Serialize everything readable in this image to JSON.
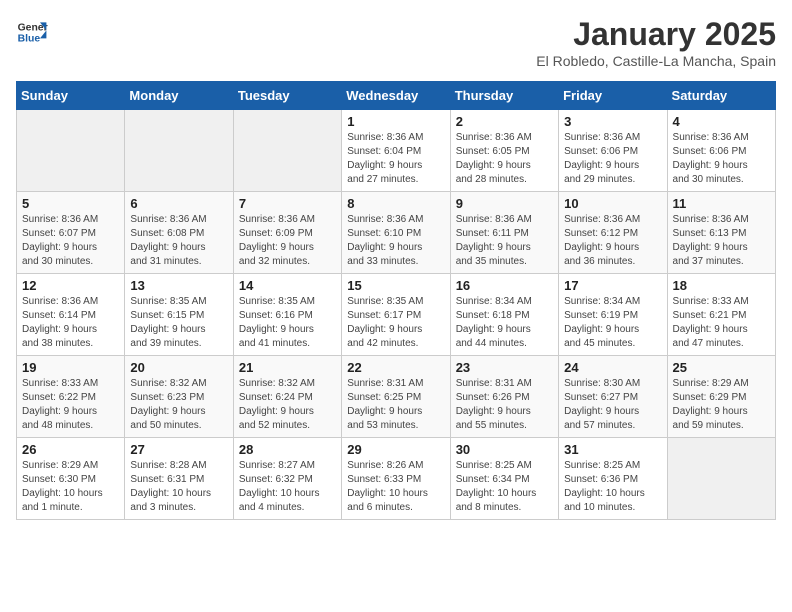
{
  "header": {
    "logo_line1": "General",
    "logo_line2": "Blue",
    "month": "January 2025",
    "location": "El Robledo, Castille-La Mancha, Spain"
  },
  "weekdays": [
    "Sunday",
    "Monday",
    "Tuesday",
    "Wednesday",
    "Thursday",
    "Friday",
    "Saturday"
  ],
  "weeks": [
    [
      {
        "day": "",
        "info": ""
      },
      {
        "day": "",
        "info": ""
      },
      {
        "day": "",
        "info": ""
      },
      {
        "day": "1",
        "info": "Sunrise: 8:36 AM\nSunset: 6:04 PM\nDaylight: 9 hours\nand 27 minutes."
      },
      {
        "day": "2",
        "info": "Sunrise: 8:36 AM\nSunset: 6:05 PM\nDaylight: 9 hours\nand 28 minutes."
      },
      {
        "day": "3",
        "info": "Sunrise: 8:36 AM\nSunset: 6:06 PM\nDaylight: 9 hours\nand 29 minutes."
      },
      {
        "day": "4",
        "info": "Sunrise: 8:36 AM\nSunset: 6:06 PM\nDaylight: 9 hours\nand 30 minutes."
      }
    ],
    [
      {
        "day": "5",
        "info": "Sunrise: 8:36 AM\nSunset: 6:07 PM\nDaylight: 9 hours\nand 30 minutes."
      },
      {
        "day": "6",
        "info": "Sunrise: 8:36 AM\nSunset: 6:08 PM\nDaylight: 9 hours\nand 31 minutes."
      },
      {
        "day": "7",
        "info": "Sunrise: 8:36 AM\nSunset: 6:09 PM\nDaylight: 9 hours\nand 32 minutes."
      },
      {
        "day": "8",
        "info": "Sunrise: 8:36 AM\nSunset: 6:10 PM\nDaylight: 9 hours\nand 33 minutes."
      },
      {
        "day": "9",
        "info": "Sunrise: 8:36 AM\nSunset: 6:11 PM\nDaylight: 9 hours\nand 35 minutes."
      },
      {
        "day": "10",
        "info": "Sunrise: 8:36 AM\nSunset: 6:12 PM\nDaylight: 9 hours\nand 36 minutes."
      },
      {
        "day": "11",
        "info": "Sunrise: 8:36 AM\nSunset: 6:13 PM\nDaylight: 9 hours\nand 37 minutes."
      }
    ],
    [
      {
        "day": "12",
        "info": "Sunrise: 8:36 AM\nSunset: 6:14 PM\nDaylight: 9 hours\nand 38 minutes."
      },
      {
        "day": "13",
        "info": "Sunrise: 8:35 AM\nSunset: 6:15 PM\nDaylight: 9 hours\nand 39 minutes."
      },
      {
        "day": "14",
        "info": "Sunrise: 8:35 AM\nSunset: 6:16 PM\nDaylight: 9 hours\nand 41 minutes."
      },
      {
        "day": "15",
        "info": "Sunrise: 8:35 AM\nSunset: 6:17 PM\nDaylight: 9 hours\nand 42 minutes."
      },
      {
        "day": "16",
        "info": "Sunrise: 8:34 AM\nSunset: 6:18 PM\nDaylight: 9 hours\nand 44 minutes."
      },
      {
        "day": "17",
        "info": "Sunrise: 8:34 AM\nSunset: 6:19 PM\nDaylight: 9 hours\nand 45 minutes."
      },
      {
        "day": "18",
        "info": "Sunrise: 8:33 AM\nSunset: 6:21 PM\nDaylight: 9 hours\nand 47 minutes."
      }
    ],
    [
      {
        "day": "19",
        "info": "Sunrise: 8:33 AM\nSunset: 6:22 PM\nDaylight: 9 hours\nand 48 minutes."
      },
      {
        "day": "20",
        "info": "Sunrise: 8:32 AM\nSunset: 6:23 PM\nDaylight: 9 hours\nand 50 minutes."
      },
      {
        "day": "21",
        "info": "Sunrise: 8:32 AM\nSunset: 6:24 PM\nDaylight: 9 hours\nand 52 minutes."
      },
      {
        "day": "22",
        "info": "Sunrise: 8:31 AM\nSunset: 6:25 PM\nDaylight: 9 hours\nand 53 minutes."
      },
      {
        "day": "23",
        "info": "Sunrise: 8:31 AM\nSunset: 6:26 PM\nDaylight: 9 hours\nand 55 minutes."
      },
      {
        "day": "24",
        "info": "Sunrise: 8:30 AM\nSunset: 6:27 PM\nDaylight: 9 hours\nand 57 minutes."
      },
      {
        "day": "25",
        "info": "Sunrise: 8:29 AM\nSunset: 6:29 PM\nDaylight: 9 hours\nand 59 minutes."
      }
    ],
    [
      {
        "day": "26",
        "info": "Sunrise: 8:29 AM\nSunset: 6:30 PM\nDaylight: 10 hours\nand 1 minute."
      },
      {
        "day": "27",
        "info": "Sunrise: 8:28 AM\nSunset: 6:31 PM\nDaylight: 10 hours\nand 3 minutes."
      },
      {
        "day": "28",
        "info": "Sunrise: 8:27 AM\nSunset: 6:32 PM\nDaylight: 10 hours\nand 4 minutes."
      },
      {
        "day": "29",
        "info": "Sunrise: 8:26 AM\nSunset: 6:33 PM\nDaylight: 10 hours\nand 6 minutes."
      },
      {
        "day": "30",
        "info": "Sunrise: 8:25 AM\nSunset: 6:34 PM\nDaylight: 10 hours\nand 8 minutes."
      },
      {
        "day": "31",
        "info": "Sunrise: 8:25 AM\nSunset: 6:36 PM\nDaylight: 10 hours\nand 10 minutes."
      },
      {
        "day": "",
        "info": ""
      }
    ]
  ]
}
